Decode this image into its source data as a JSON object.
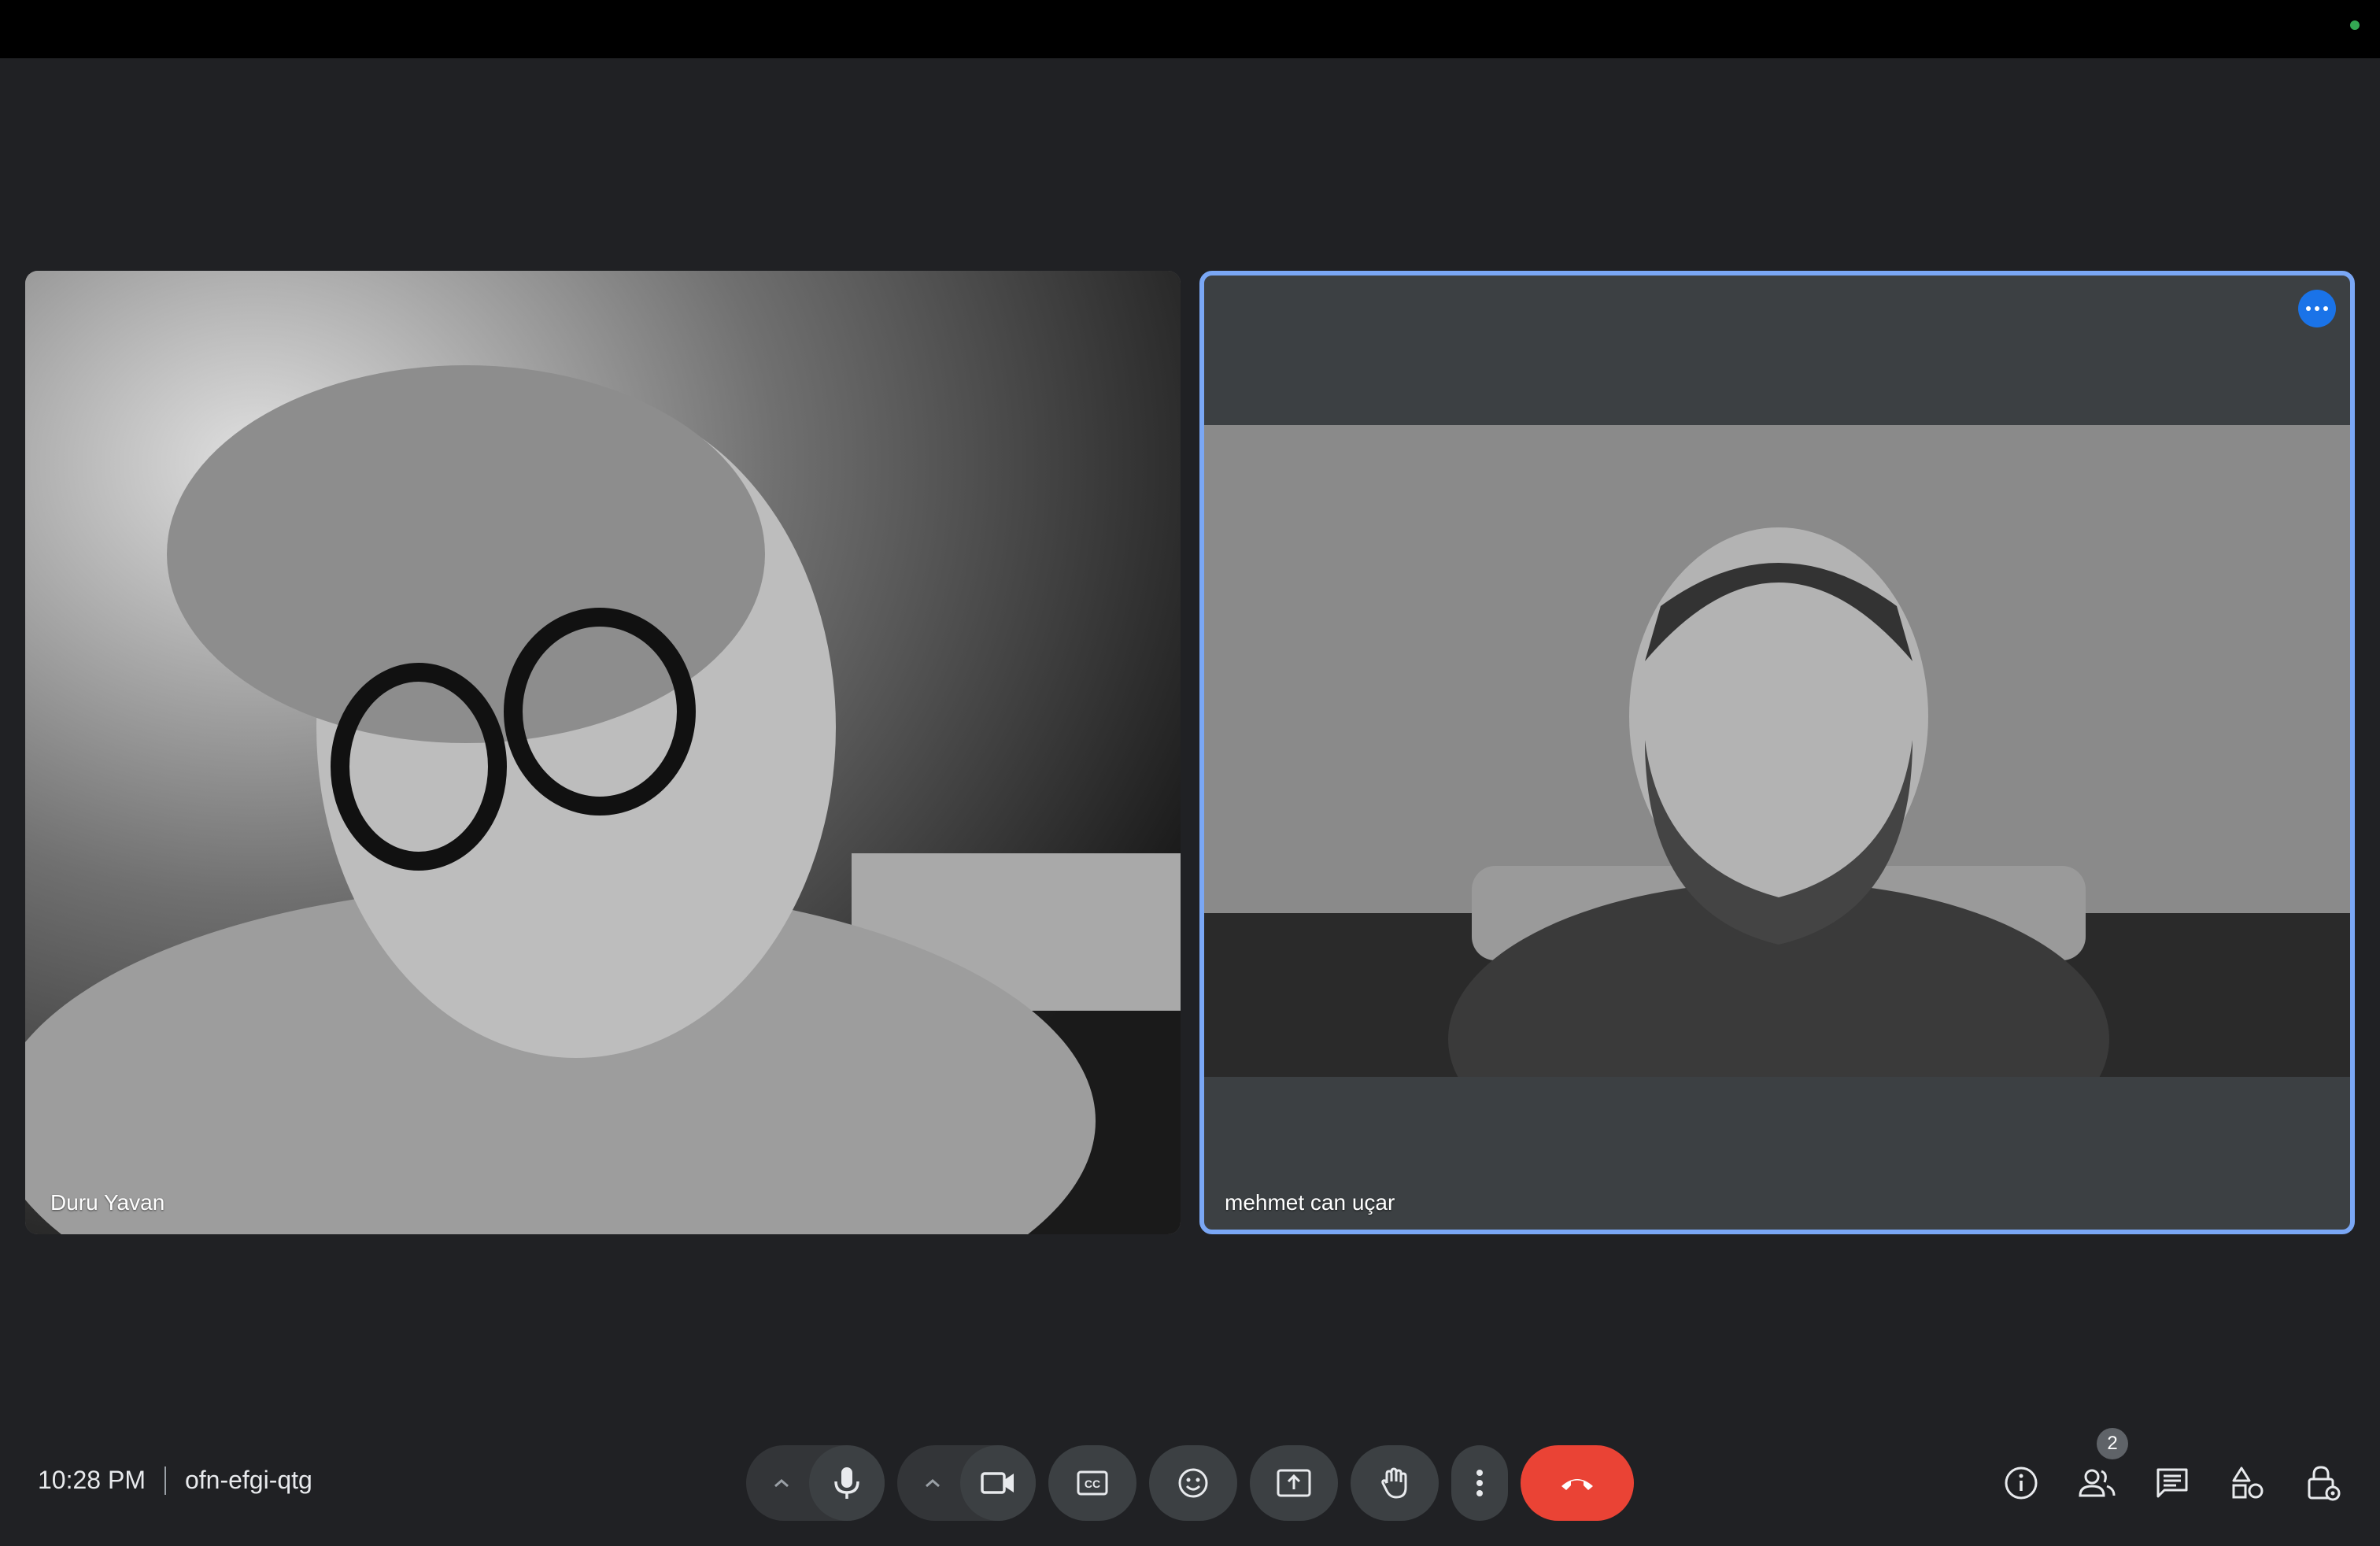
{
  "participants": [
    {
      "name": "Duru Yavan"
    },
    {
      "name": "mehmet can uçar"
    }
  ],
  "meeting": {
    "time": "10:28 PM",
    "code": "ofn-efgi-qtg"
  },
  "people_count": "2",
  "colors": {
    "background": "#202124",
    "active_border": "#7aa7f5",
    "end_call": "#ea4335",
    "accent": "#1a73e8"
  },
  "icons": [
    "mic-icon",
    "camera-icon",
    "captions-icon",
    "emoji-icon",
    "present-icon",
    "raise-hand-icon",
    "more-options-icon",
    "end-call-icon",
    "info-icon",
    "people-icon",
    "chat-icon",
    "activities-icon",
    "host-controls-icon"
  ]
}
